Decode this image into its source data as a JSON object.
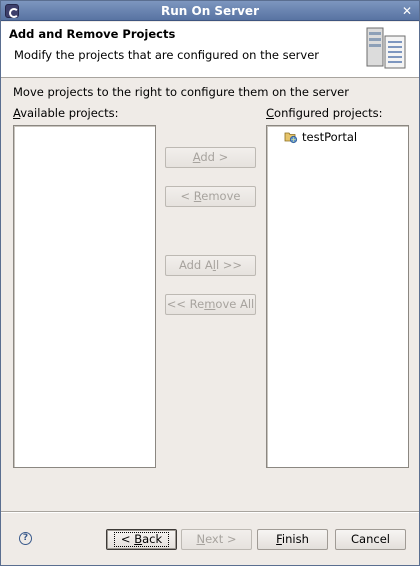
{
  "window": {
    "title": "Run On Server",
    "close_glyph": "✕"
  },
  "banner": {
    "heading": "Add and Remove Projects",
    "description": "Modify the projects that are configured on the server",
    "icon": "server-icon"
  },
  "instructions": "Move projects to the right to configure them on the server",
  "available": {
    "label_first": "A",
    "label_rest": "vailable projects:",
    "items": []
  },
  "configured": {
    "label_first": "C",
    "label_rest": "onfigured projects:",
    "items": [
      {
        "label": "testPortal",
        "icon": "project-icon"
      }
    ]
  },
  "buttons": {
    "add": {
      "pre": "",
      "mn": "A",
      "post": "dd >",
      "enabled": false
    },
    "remove": {
      "pre": "< ",
      "mn": "R",
      "post": "emove",
      "enabled": false
    },
    "add_all": {
      "pre": "Add A",
      "mn": "l",
      "post": "l >>",
      "enabled": false
    },
    "remove_all": {
      "pre": "<< Re",
      "mn": "m",
      "post": "ove All",
      "enabled": false
    }
  },
  "footer": {
    "help_glyph": "?",
    "back": {
      "pre": "< ",
      "mn": "B",
      "post": "ack"
    },
    "next": {
      "pre": "",
      "mn": "N",
      "post": "ext >"
    },
    "finish": {
      "pre": "",
      "mn": "F",
      "post": "inish"
    },
    "cancel": {
      "label": "Cancel"
    }
  },
  "colors": {
    "titlebar": "#5873a2",
    "panel": "#efebe7",
    "disabled_text": "#a7a39e"
  }
}
